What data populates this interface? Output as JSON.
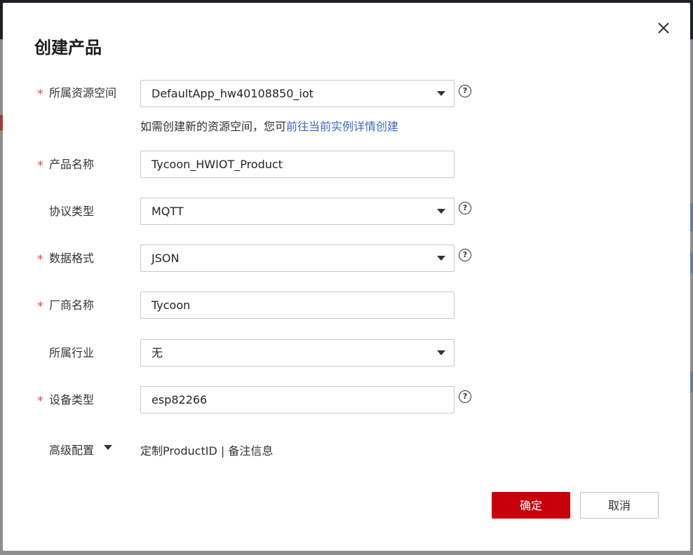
{
  "dialog": {
    "title": "创建产品",
    "close_icon": "close-icon"
  },
  "form": {
    "resource_space": {
      "label": "所属资源空间",
      "required": true,
      "value": "DefaultApp_hw40108850_iot",
      "hint_text": "如需创建新的资源空间，您可",
      "hint_link": "前往当前实例详情创建"
    },
    "product_name": {
      "label": "产品名称",
      "required": true,
      "value": "Tycoon_HWIOT_Product"
    },
    "protocol_type": {
      "label": "协议类型",
      "required": false,
      "value": "MQTT"
    },
    "data_format": {
      "label": "数据格式",
      "required": true,
      "value": "JSON"
    },
    "manufacturer": {
      "label": "厂商名称",
      "required": true,
      "value": "Tycoon"
    },
    "industry": {
      "label": "所属行业",
      "required": false,
      "value": "无"
    },
    "device_type": {
      "label": "设备类型",
      "required": true,
      "value": "esp82266"
    },
    "advanced": {
      "label": "高级配置",
      "summary": "定制ProductID | 备注信息"
    },
    "required_mark": "*",
    "help_mark": "?"
  },
  "footer": {
    "confirm_label": "确定",
    "cancel_label": "取消"
  },
  "colors": {
    "primary": "#c7000b",
    "link": "#3f69c8",
    "required": "#e2564a"
  }
}
